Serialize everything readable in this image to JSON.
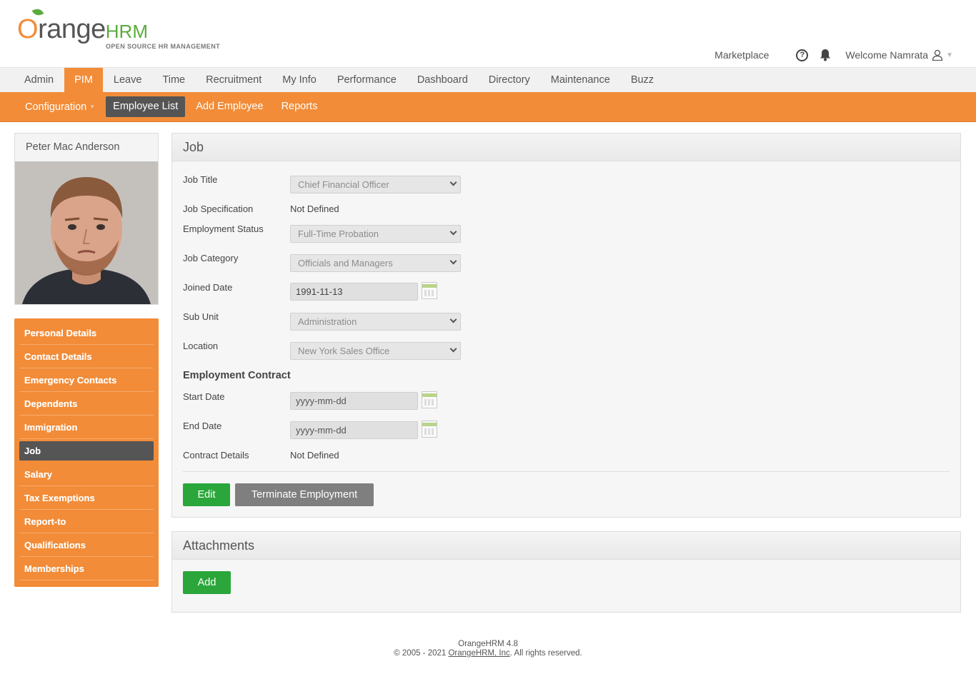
{
  "brand": {
    "logo_main_o": "O",
    "logo_main_rest": "range",
    "logo_hrm": "HRM",
    "logo_tagline": "OPEN SOURCE HR MANAGEMENT"
  },
  "topbar": {
    "marketplace": "Marketplace",
    "help_icon": "help-circle-icon",
    "help_glyph": "?",
    "notification_icon": "bell-icon",
    "welcome": "Welcome Namrata",
    "user_icon": "user-icon",
    "caret": "▼"
  },
  "main_menu": [
    {
      "label": "Admin",
      "active": false
    },
    {
      "label": "PIM",
      "active": true
    },
    {
      "label": "Leave",
      "active": false
    },
    {
      "label": "Time",
      "active": false
    },
    {
      "label": "Recruitment",
      "active": false
    },
    {
      "label": "My Info",
      "active": false
    },
    {
      "label": "Performance",
      "active": false
    },
    {
      "label": "Dashboard",
      "active": false
    },
    {
      "label": "Directory",
      "active": false
    },
    {
      "label": "Maintenance",
      "active": false
    },
    {
      "label": "Buzz",
      "active": false
    }
  ],
  "sub_menu": [
    {
      "label": "Configuration",
      "active": false,
      "dropdown": true,
      "tri": "▼"
    },
    {
      "label": "Employee List",
      "active": true
    },
    {
      "label": "Add Employee",
      "active": false
    },
    {
      "label": "Reports",
      "active": false
    }
  ],
  "profile": {
    "name": "Peter Mac Anderson"
  },
  "side_nav": [
    {
      "label": "Personal Details",
      "active": false
    },
    {
      "label": "Contact Details",
      "active": false
    },
    {
      "label": "Emergency Contacts",
      "active": false
    },
    {
      "label": "Dependents",
      "active": false
    },
    {
      "label": "Immigration",
      "active": false
    },
    {
      "label": "Job",
      "active": true
    },
    {
      "label": "Salary",
      "active": false
    },
    {
      "label": "Tax Exemptions",
      "active": false
    },
    {
      "label": "Report-to",
      "active": false
    },
    {
      "label": "Qualifications",
      "active": false
    },
    {
      "label": "Memberships",
      "active": false
    }
  ],
  "job": {
    "title": "Job",
    "job_title_label": "Job Title",
    "job_title_value": "Chief Financial Officer",
    "job_spec_label": "Job Specification",
    "job_spec_value": "Not Defined",
    "emp_status_label": "Employment Status",
    "emp_status_value": "Full-Time Probation",
    "job_category_label": "Job Category",
    "job_category_value": "Officials and Managers",
    "joined_date_label": "Joined Date",
    "joined_date_value": "1991-11-13",
    "sub_unit_label": "Sub Unit",
    "sub_unit_value": "Administration",
    "location_label": "Location",
    "location_value": "New York Sales Office",
    "contract_title": "Employment Contract",
    "start_date_label": "Start Date",
    "start_date_placeholder": "yyyy-mm-dd",
    "end_date_label": "End Date",
    "end_date_placeholder": "yyyy-mm-dd",
    "contract_details_label": "Contract Details",
    "contract_details_value": "Not Defined",
    "edit_button": "Edit",
    "terminate_button": "Terminate Employment"
  },
  "attachments": {
    "title": "Attachments",
    "add_button": "Add"
  },
  "footer": {
    "version": "OrangeHRM 4.8",
    "copyright_prefix": "© 2005 - 2021 ",
    "company_link": "OrangeHRM, Inc",
    "copyright_suffix": ". All rights reserved."
  },
  "colors": {
    "accent_orange": "#f28c38",
    "active_dark": "#555555",
    "button_green": "#2aa63a",
    "button_grey": "#7f7f7f",
    "brand_green": "#5bab3c"
  }
}
